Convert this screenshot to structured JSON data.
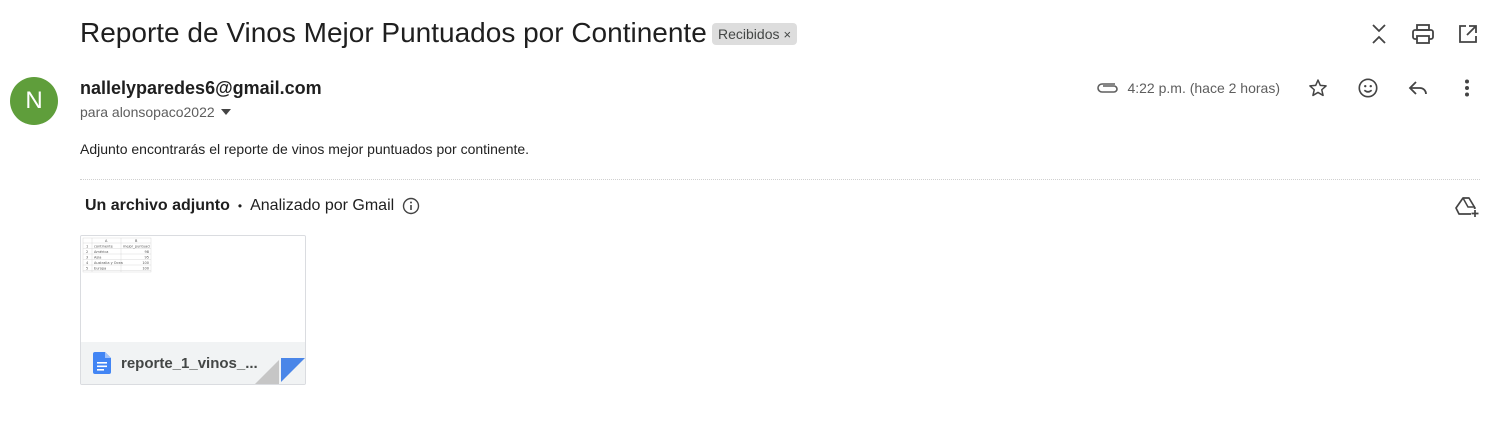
{
  "email": {
    "subject": "Reporte de Vinos Mejor Puntuados por Continente",
    "label": "Recibidos",
    "label_close": "×",
    "sender": {
      "avatar_letter": "N",
      "avatar_color": "#5f9e3b",
      "email": "nallelyparedes6@gmail.com",
      "to": "para alonsopaco2022",
      "time": "4:22 p.m. (hace 2 horas)"
    },
    "body": "Adjunto encontrarás el reporte de vinos mejor puntuados por continente.",
    "attachments": {
      "header": "Un archivo adjunto",
      "separator": "•",
      "scanned": "Analizado por Gmail",
      "file": {
        "name": "reporte_1_vinos_...",
        "icon": "google-docs-icon",
        "preview": {
          "col_headers": [
            "A",
            "B"
          ],
          "rows": [
            [
              "1",
              "continente",
              "mejor_puntuaci"
            ],
            [
              "2",
              "América",
              "98"
            ],
            [
              "3",
              "Asia",
              "95"
            ],
            [
              "4",
              "Australia y Ocea",
              "100"
            ],
            [
              "5",
              "Europa",
              "100"
            ]
          ]
        }
      }
    }
  },
  "icons": {
    "expand": "unfold-icon",
    "print": "print-icon",
    "popout": "open-in-new-icon",
    "attach": "paperclip-icon",
    "star": "star-icon",
    "emoji": "emoji-icon",
    "reply": "reply-icon",
    "more": "more-vert-icon",
    "add_drive": "add-to-drive-icon",
    "info": "info-icon",
    "dropdown": "caret-down-icon"
  }
}
